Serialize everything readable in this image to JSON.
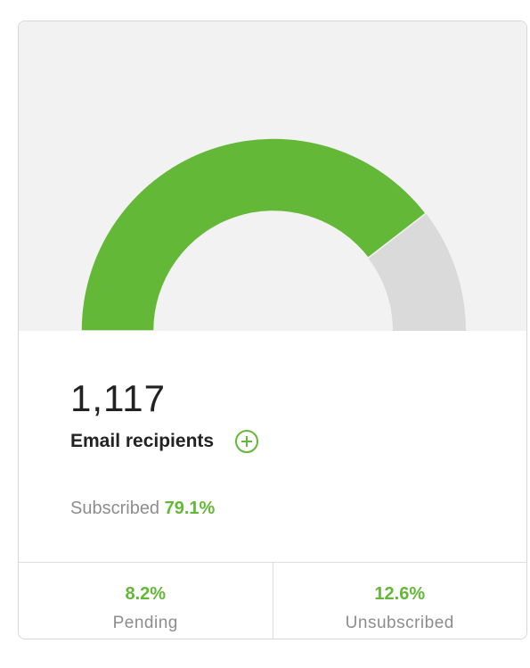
{
  "card": {
    "total": "1,117",
    "label": "Email recipients",
    "add_icon": "plus-circle-icon",
    "subscribed_label": "Subscribed",
    "subscribed_value": "79.1%"
  },
  "footer": {
    "pending": {
      "value": "8.2%",
      "label": "Pending"
    },
    "unsubscribed": {
      "value": "12.6%",
      "label": "Unsubscribed"
    }
  },
  "gauge": {
    "filled_fraction": 0.791,
    "filled_color": "#64b837",
    "remaining_color": "#dadada",
    "background_color": "#f2f2f2"
  }
}
